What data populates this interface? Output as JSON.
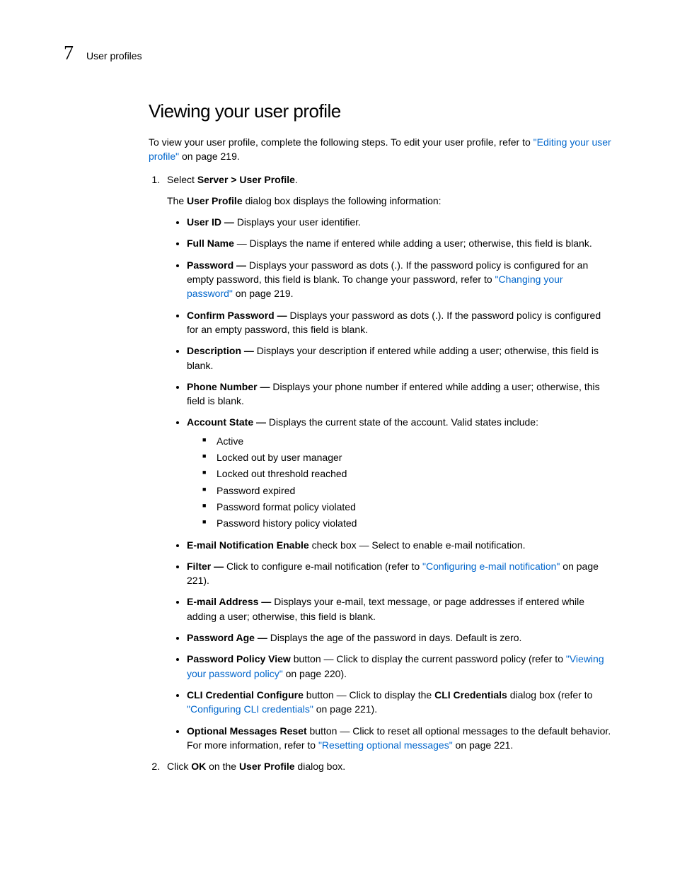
{
  "header": {
    "chapter": "7",
    "title": "User profiles"
  },
  "section": {
    "title": "Viewing your user profile",
    "intro_pre": "To view your user profile, complete the following steps. To edit your user profile, refer to ",
    "intro_link": "\"Editing your user profile\"",
    "intro_post": " on page 219."
  },
  "step1": {
    "prefix": "Select ",
    "menu": "Server > User Profile",
    "suffix": ".",
    "dialog_pre": "The ",
    "dialog_name": "User Profile",
    "dialog_post": " dialog box displays the following information:"
  },
  "fields": {
    "user_id": {
      "label": "User ID — ",
      "desc": "Displays your user identifier."
    },
    "full_name": {
      "label": "Full Name",
      "desc": " — Displays the name if entered while adding a user; otherwise, this field is blank."
    },
    "password": {
      "label": "Password — ",
      "pre": "Displays your password as dots (.). If the password policy is configured for an empty password, this field is blank. To change your password, refer to ",
      "link": "\"Changing your password\"",
      "post": " on page 219."
    },
    "confirm_password": {
      "label": "Confirm Password — ",
      "desc": "Displays your password as dots (.). If the password policy is configured for an empty password, this field is blank."
    },
    "description": {
      "label": "Description — ",
      "desc": "Displays your description if entered while adding a user; otherwise, this field is blank."
    },
    "phone": {
      "label": "Phone Number — ",
      "desc": "Displays your phone number if entered while adding a user; otherwise, this field is blank."
    },
    "account_state": {
      "label": "Account State — ",
      "desc": "Displays the current state of the account. Valid states include:",
      "states": [
        "Active",
        "Locked out by user manager",
        "Locked out threshold reached",
        "Password expired",
        "Password format policy violated",
        "Password history policy violated"
      ]
    },
    "email_enable": {
      "label": "E-mail Notification Enable",
      "desc": " check box — Select to enable e-mail notification."
    },
    "filter": {
      "label": "Filter — ",
      "pre": "Click to configure e-mail notification (refer to ",
      "link": "\"Configuring e-mail notification\"",
      "post": " on page 221)."
    },
    "email_address": {
      "label": "E-mail Address — ",
      "desc": "Displays your e-mail, text message, or page addresses if entered while adding a user; otherwise, this field is blank."
    },
    "password_age": {
      "label": "Password Age — ",
      "desc": "Displays the age of the password in days. Default is zero."
    },
    "policy_view": {
      "label": "Password Policy View",
      "mid": " button  — Click to display the current password policy (refer to ",
      "link": "\"Viewing your password policy\"",
      "post": " on page 220)."
    },
    "cli": {
      "label": "CLI Credential Configure",
      "mid1": " button — Click to display the ",
      "bold2": "CLI Credentials",
      "mid2": " dialog box (refer to ",
      "link": "\"Configuring CLI credentials\"",
      "post": " on page 221)."
    },
    "optional": {
      "label": "Optional Messages Reset",
      "mid": " button — Click to reset all optional messages to the default behavior. For more information, refer to ",
      "link": "\"Resetting optional messages\"",
      "post": " on page 221."
    }
  },
  "step2": {
    "pre": "Click ",
    "ok": "OK",
    "mid": " on the ",
    "dialog": "User Profile",
    "post": " dialog box."
  }
}
